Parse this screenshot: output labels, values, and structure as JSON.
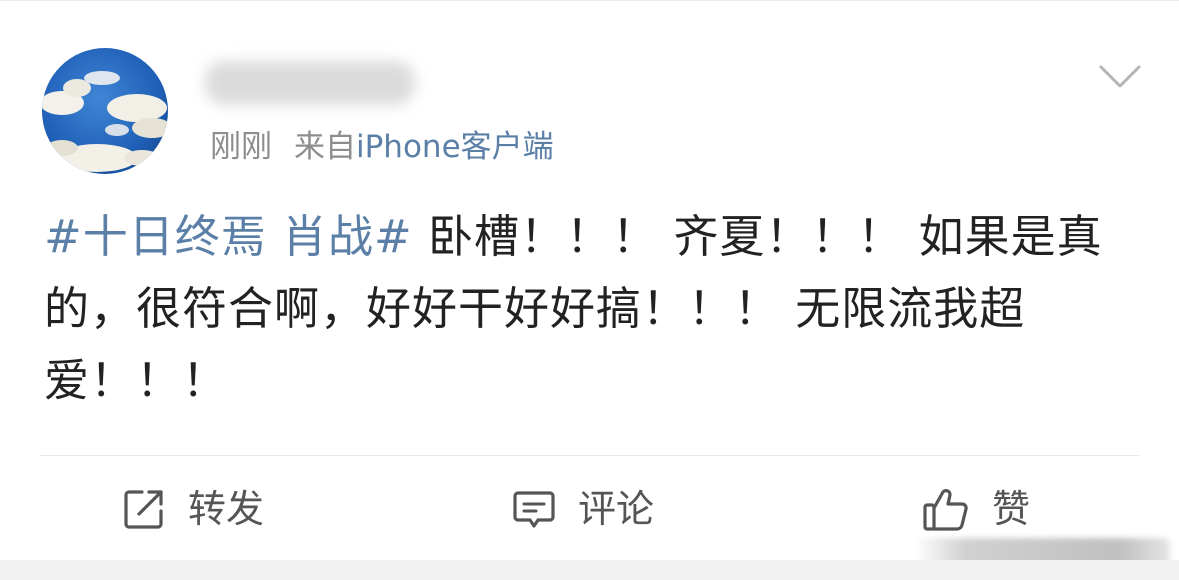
{
  "post": {
    "author_name": "",
    "time": "刚刚",
    "source_prefix": "来自",
    "source_client": "iPhone客户端",
    "topic": "#十日终焉 肖战#",
    "body_text": " 卧槽！！！ 齐夏！！！ 如果是真的，很符合啊，好好干好好搞！！！ 无限流我超爱！！！"
  },
  "actions": {
    "repost_label": "转发",
    "comment_label": "评论",
    "like_label": "赞"
  },
  "icons": {
    "menu": "chevron-down-icon",
    "repost": "share-edit-icon",
    "comment": "comment-bubble-icon",
    "like": "thumbs-up-icon"
  },
  "colors": {
    "link": "#5b7fa7",
    "text": "#222222",
    "meta": "#8d8d8d",
    "action_icon": "#555555"
  }
}
